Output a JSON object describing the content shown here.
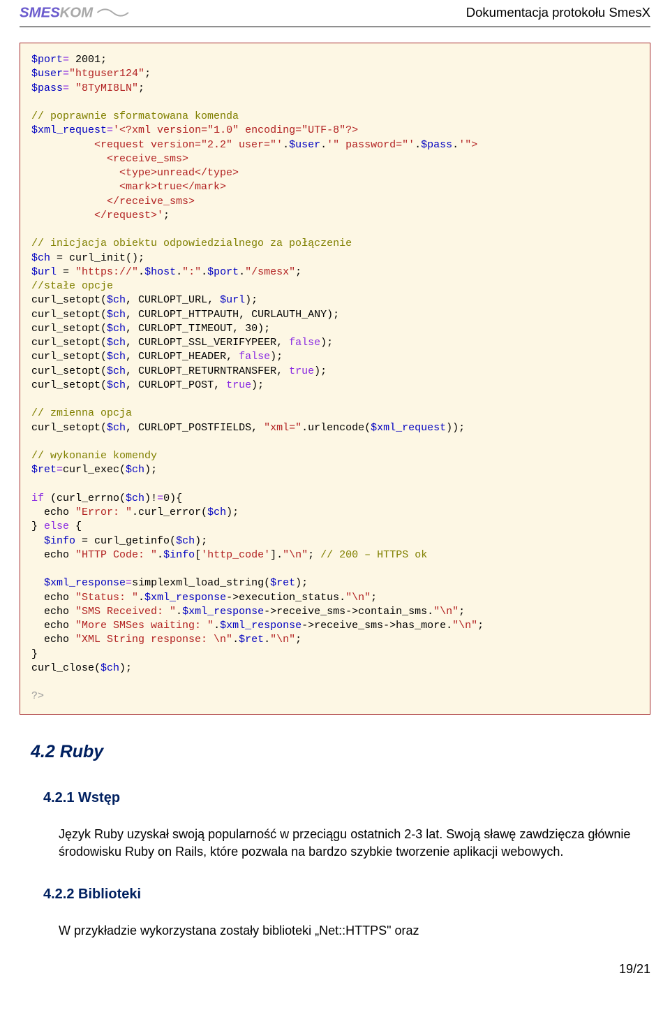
{
  "header": {
    "logo_text": "SMESKOM",
    "doc_title": "Dokumentacja protokołu SmesX"
  },
  "code": {
    "l01_var": "$port",
    "l01_op": "=",
    "l01_num": " 2001;",
    "l02_var": "$user",
    "l02_op": "=",
    "l02_str": "\"htguser124\"",
    "l02_end": ";",
    "l03_var": "$pass",
    "l03_op": "= ",
    "l03_str": "\"8TyMI8LN\"",
    "l03_end": ";",
    "l04": "// poprawnie sformatowana komenda",
    "l05_var": "$xml_request",
    "l05_op": "=",
    "l05_str": "'<?xml version=\"1.0\" encoding=\"UTF-8\"?>",
    "l06": "          <request version=\"2.2\" user=\"'",
    "l06b": ".",
    "l06c": "$user",
    "l06d": ".",
    "l06e": "'\" password=\"'",
    "l06f": ".",
    "l06g": "$pass",
    "l06h": ".",
    "l06i": "'\">",
    "l07": "            <receive_sms>",
    "l08": "              <type>unread</type>",
    "l09": "              <mark>true</mark>",
    "l10": "            </receive_sms>",
    "l11": "          </request>'",
    "l11b": ";",
    "l12": "// inicjacja obiektu odpowiedzialnego za połączenie",
    "l13_var": "$ch",
    "l13_eq": " = ",
    "l13_fn": "curl_init();",
    "l14_var": "$url",
    "l14_eq": " = ",
    "l14_s1": "\"https://\"",
    "l14_d1": ".",
    "l14_v1": "$host",
    "l14_d2": ".",
    "l14_s2": "\":\"",
    "l14_d3": ".",
    "l14_v2": "$port",
    "l14_d4": ".",
    "l14_s3": "\"/smesx\"",
    "l14_end": ";",
    "l15": "//stałe opcje",
    "l16a": "curl_setopt(",
    "l16b": "$ch",
    "l16c": ", CURLOPT_URL, ",
    "l16d": "$url",
    "l16e": ");",
    "l17a": "curl_setopt(",
    "l17b": "$ch",
    "l17c": ", CURLOPT_HTTPAUTH, CURLAUTH_ANY);",
    "l18a": "curl_setopt(",
    "l18b": "$ch",
    "l18c": ", CURLOPT_TIMEOUT, 30);",
    "l19a": "curl_setopt(",
    "l19b": "$ch",
    "l19c": ", CURLOPT_SSL_VERIFYPEER, ",
    "l19d": "false",
    "l19e": ");",
    "l20a": "curl_setopt(",
    "l20b": "$ch",
    "l20c": ", CURLOPT_HEADER, ",
    "l20d": "false",
    "l20e": ");",
    "l21a": "curl_setopt(",
    "l21b": "$ch",
    "l21c": ", CURLOPT_RETURNTRANSFER, ",
    "l21d": "true",
    "l21e": ");",
    "l22a": "curl_setopt(",
    "l22b": "$ch",
    "l22c": ", CURLOPT_POST, ",
    "l22d": "true",
    "l22e": ");",
    "l23": "// zmienna opcja",
    "l24a": "curl_setopt(",
    "l24b": "$ch",
    "l24c": ", CURLOPT_POSTFIELDS, ",
    "l24d": "\"xml=\"",
    "l24e": ".urlencode(",
    "l24f": "$xml_request",
    "l24g": "));",
    "l25": "// wykonanie komendy",
    "l26a": "$ret",
    "l26b": "=",
    "l26c": "curl_exec(",
    "l26d": "$ch",
    "l26e": ");",
    "l27a": "if",
    "l27b": " (curl_errno(",
    "l27c": "$ch",
    "l27d": ")!",
    "l27e": "=",
    "l27f": "0){",
    "l28a": "  echo ",
    "l28b": "\"Error: \"",
    "l28c": ".curl_error(",
    "l28d": "$ch",
    "l28e": ");",
    "l29a": "} ",
    "l29b": "else",
    "l29c": " {",
    "l30a": "  ",
    "l30b": "$info",
    "l30c": " = curl_getinfo(",
    "l30d": "$ch",
    "l30e": ");",
    "l31a": "  echo ",
    "l31b": "\"HTTP Code: \"",
    "l31c": ".",
    "l31d": "$info",
    "l31e": "[",
    "l31f": "'http_code'",
    "l31g": "].",
    "l31h": "\"\\n\"",
    "l31i": "; ",
    "l31j": "// 200 – HTTPS ok",
    "l32a": "  ",
    "l32b": "$xml_response",
    "l32c": "=",
    "l32d": "simplexml_load_string(",
    "l32e": "$ret",
    "l32f": ");",
    "l33a": "  echo ",
    "l33b": "\"Status: \"",
    "l33c": ".",
    "l33d": "$xml_response",
    "l33e": "->execution_status.",
    "l33f": "\"\\n\"",
    "l33g": ";",
    "l34a": "  echo ",
    "l34b": "\"SMS Received: \"",
    "l34c": ".",
    "l34d": "$xml_response",
    "l34e": "->receive_sms->contain_sms.",
    "l34f": "\"\\n\"",
    "l34g": ";",
    "l35a": "  echo ",
    "l35b": "\"More SMSes waiting: \"",
    "l35c": ".",
    "l35d": "$xml_response",
    "l35e": "->receive_sms->has_more.",
    "l35f": "\"\\n\"",
    "l35g": ";",
    "l36a": "  echo ",
    "l36b": "\"XML String response: \\n\"",
    "l36c": ".",
    "l36d": "$ret",
    "l36e": ".",
    "l36f": "\"\\n\"",
    "l36g": ";",
    "l37": "}",
    "l38a": "curl_close(",
    "l38b": "$ch",
    "l38c": ");",
    "l39": "?>"
  },
  "headings": {
    "h2": "4.2 Ruby",
    "h3_1": "4.2.1 Wstęp",
    "h3_2": "4.2.2 Biblioteki"
  },
  "paragraphs": {
    "p1": "Język Ruby uzyskał swoją popularność w przeciągu ostatnich 2-3 lat. Swoją sławę zawdzięcza głównie środowisku Ruby on Rails, które pozwala na bardzo szybkie tworzenie aplikacji webowych.",
    "p2": "W przykładzie wykorzystana zostały biblioteki „Net::HTTPS\" oraz"
  },
  "footer": {
    "page": "19/21"
  }
}
